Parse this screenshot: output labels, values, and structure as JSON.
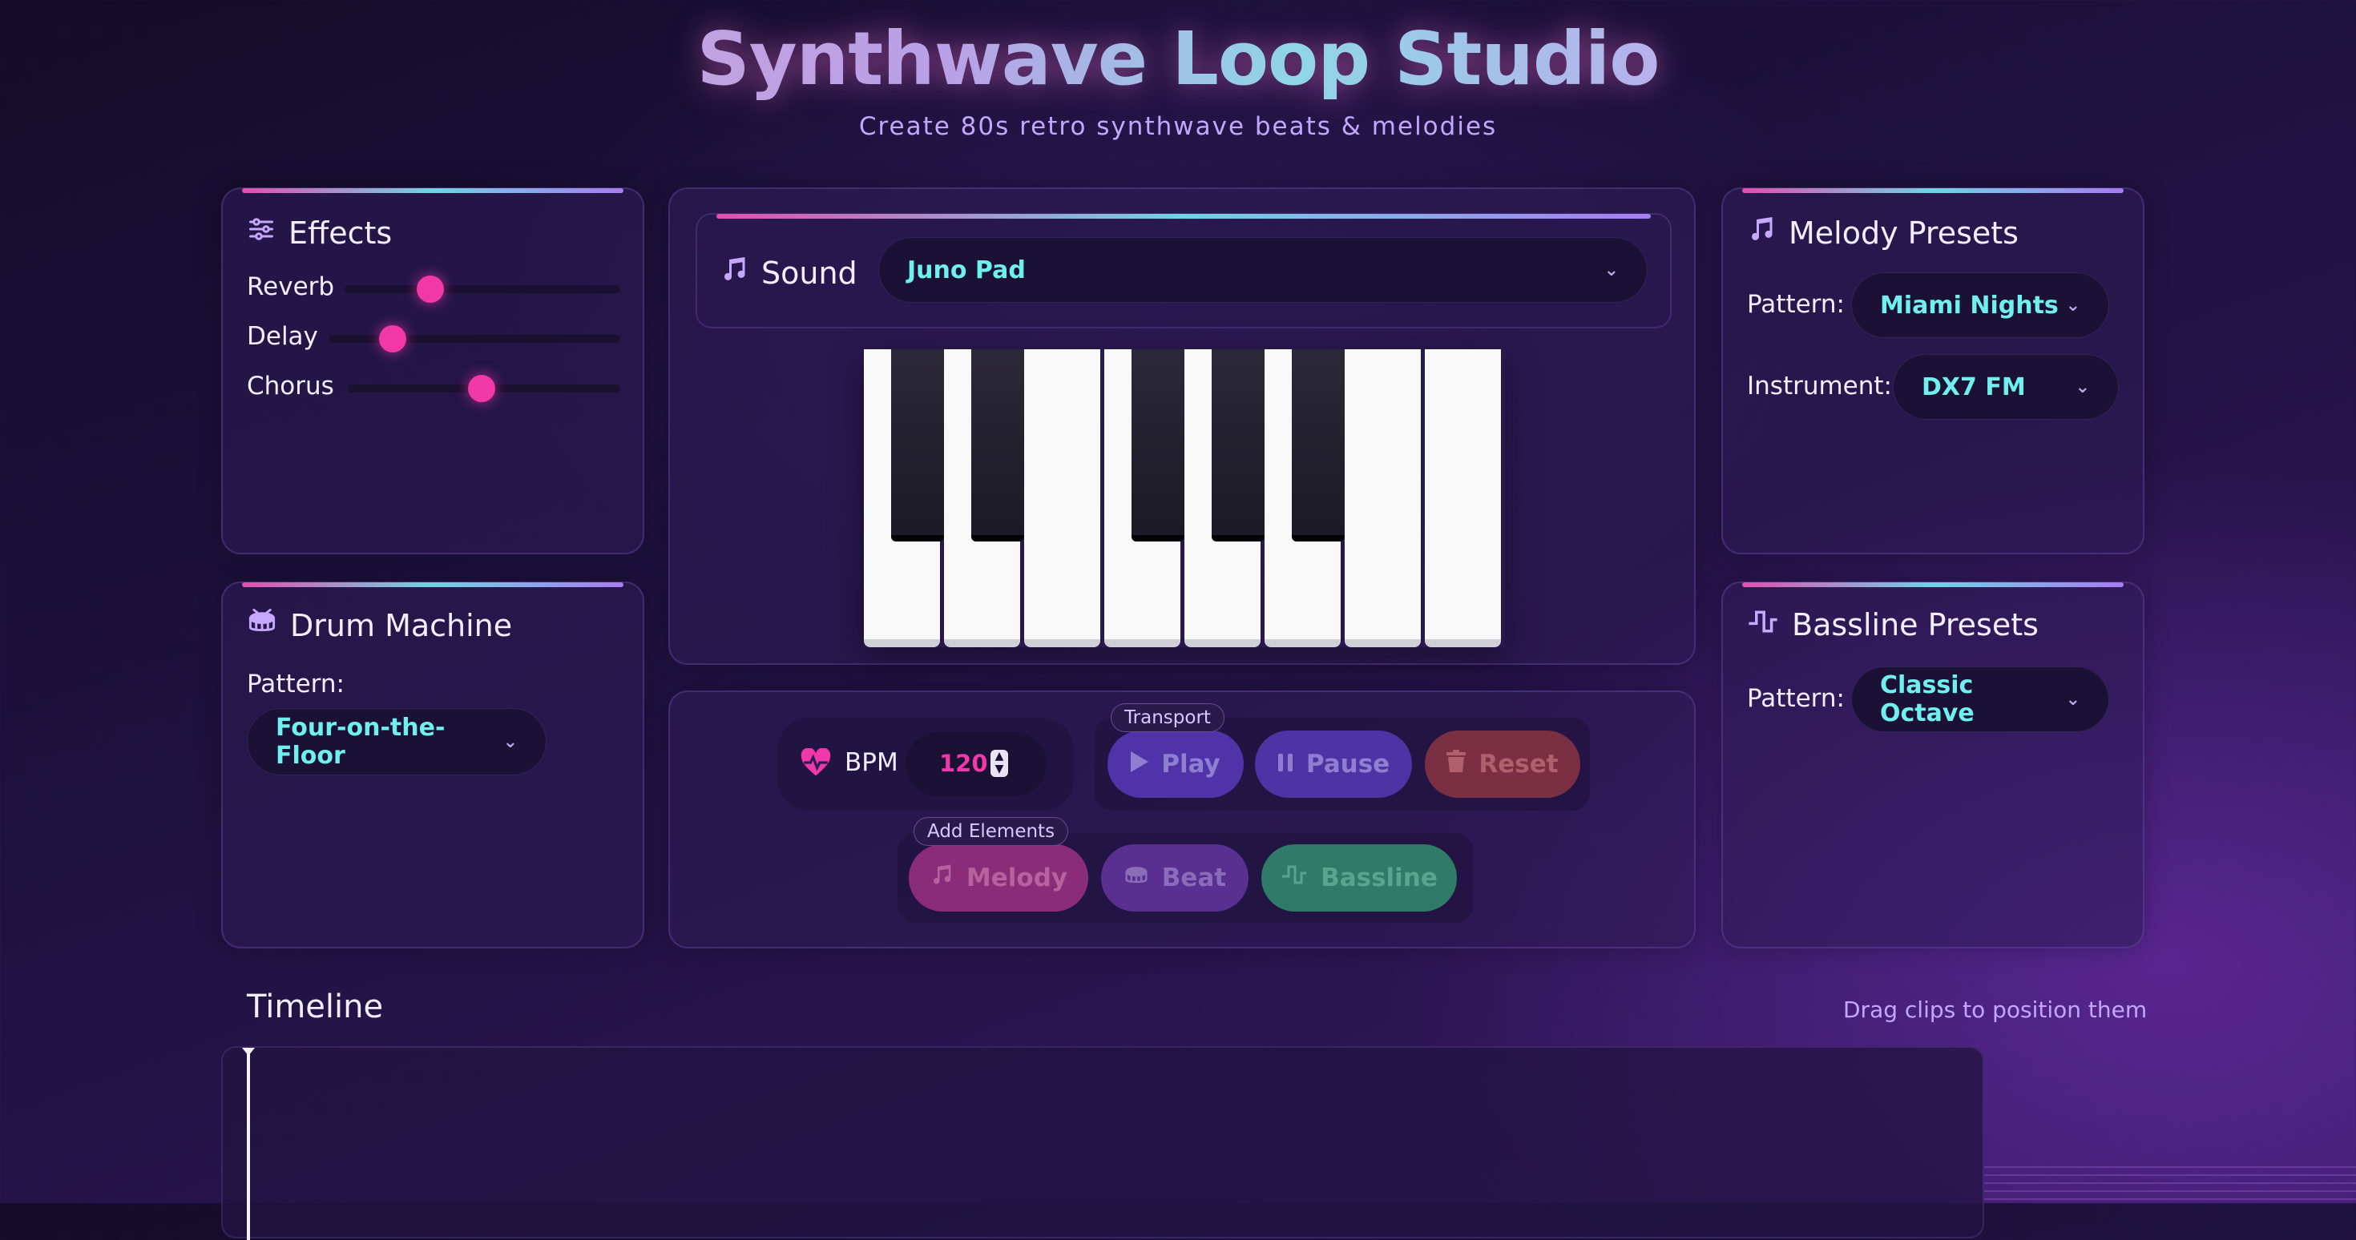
{
  "header": {
    "title": "Synthwave Loop Studio",
    "subtitle": "Create 80s retro synthwave beats & melodies"
  },
  "effects": {
    "title": "Effects",
    "title_icon": "sliders-icon",
    "sliders": [
      {
        "label": "Reverb",
        "value": 0.32
      },
      {
        "label": "Delay",
        "value": 0.22
      },
      {
        "label": "Chorus",
        "value": 0.5
      }
    ]
  },
  "drum_machine": {
    "title": "Drum Machine",
    "title_icon": "drum-icon",
    "pattern_label": "Pattern:",
    "pattern_value": "Four-on-the-Floor"
  },
  "sound": {
    "title": "Sound",
    "title_icon": "music-note-icon",
    "selected": "Juno Pad"
  },
  "piano": {
    "white_keys": 8,
    "black_keys": 5
  },
  "controls": {
    "bpm_label": "BPM",
    "bpm_value": "120",
    "transport_label": "Transport",
    "play": "Play",
    "pause": "Pause",
    "reset": "Reset",
    "add_elements_label": "Add Elements",
    "melody": "Melody",
    "beat": "Beat",
    "bassline": "Bassline"
  },
  "melody_presets": {
    "title": "Melody Presets",
    "title_icon": "music-note-icon",
    "pattern_label": "Pattern:",
    "pattern_value": "Miami Nights",
    "instrument_label": "Instrument:",
    "instrument_value": "DX7 FM"
  },
  "bassline_presets": {
    "title": "Bassline Presets",
    "title_icon": "square-wave-icon",
    "pattern_label": "Pattern:",
    "pattern_value": "Classic Octave"
  },
  "timeline": {
    "title": "Timeline",
    "hint": "Drag clips to position them"
  },
  "colors": {
    "accent_pink": "#f038a8",
    "accent_cyan": "#6ff0ef",
    "accent_purple": "#a77cf0"
  }
}
